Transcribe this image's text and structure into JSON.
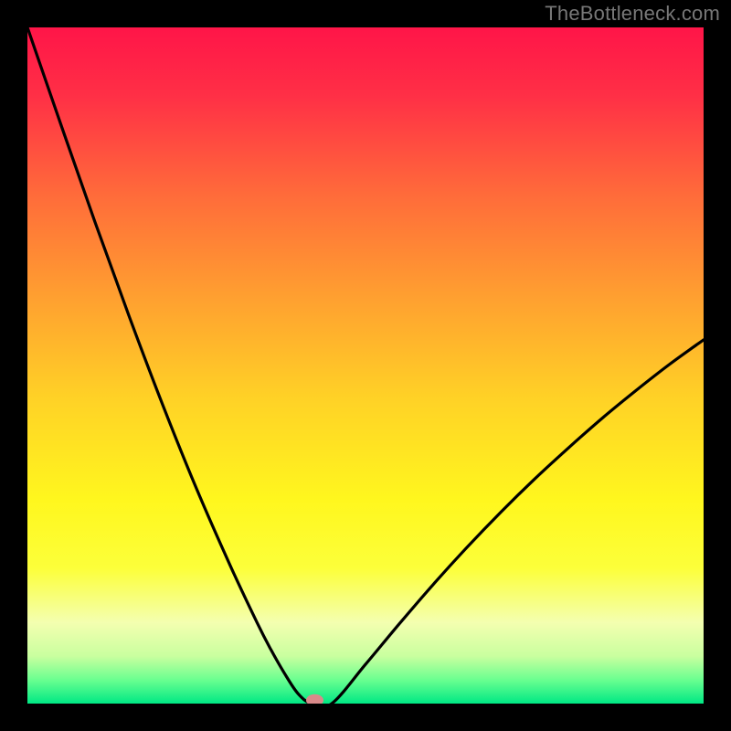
{
  "watermark": "TheBottleneck.com",
  "chart_data": {
    "type": "line",
    "title": "",
    "xlabel": "",
    "ylabel": "",
    "xlim": [
      0,
      100
    ],
    "ylim": [
      0,
      100
    ],
    "series": [
      {
        "name": "bottleneck-curve",
        "x": [
          0,
          5,
          10,
          15,
          20,
          25,
          30,
          34,
          36,
          38,
          40,
          42,
          45,
          50,
          55,
          60,
          65,
          70,
          75,
          80,
          85,
          90,
          95,
          100
        ],
        "y": [
          100,
          85.5,
          71.2,
          57.4,
          44.2,
          31.8,
          20.4,
          11.9,
          8.0,
          4.5,
          1.5,
          0,
          0,
          5.8,
          11.8,
          17.6,
          23.1,
          28.3,
          33.2,
          37.8,
          42.2,
          46.3,
          50.2,
          53.8
        ]
      }
    ],
    "marker": {
      "name": "optimal-point",
      "x": 42.5,
      "y": 0.5,
      "color": "#d98a8a"
    },
    "background_gradient": {
      "stops": [
        {
          "pos": 0.0,
          "color": "#ff1548"
        },
        {
          "pos": 0.1,
          "color": "#ff2f46"
        },
        {
          "pos": 0.25,
          "color": "#ff6c3a"
        },
        {
          "pos": 0.4,
          "color": "#ffa030"
        },
        {
          "pos": 0.55,
          "color": "#ffd226"
        },
        {
          "pos": 0.7,
          "color": "#fff71e"
        },
        {
          "pos": 0.8,
          "color": "#fcff3a"
        },
        {
          "pos": 0.88,
          "color": "#f4ffb0"
        },
        {
          "pos": 0.93,
          "color": "#c9ff9f"
        },
        {
          "pos": 0.965,
          "color": "#6aff90"
        },
        {
          "pos": 1.0,
          "color": "#00e884"
        }
      ]
    }
  }
}
